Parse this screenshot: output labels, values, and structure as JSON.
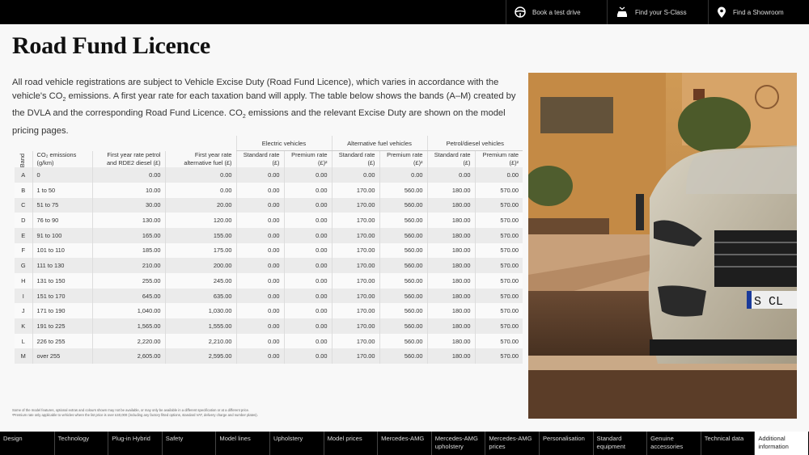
{
  "topbar": {
    "items": [
      {
        "label": "Book a test drive",
        "icon": "steering-wheel-icon"
      },
      {
        "label": "Find your S-Class",
        "icon": "car-search-icon"
      },
      {
        "label": "Find a Showroom",
        "icon": "map-pin-icon"
      }
    ]
  },
  "page": {
    "title": "Road Fund Licence",
    "intro_part1": "All road vehicle registrations are subject to Vehicle Excise Duty (Road Fund Licence), which varies in accordance with the vehicle's CO",
    "intro_part2": " emissions. A first year rate for each taxation band will apply. The table below shows the bands (A–M) created by the DVLA and the corresponding Road Fund Licence. CO",
    "intro_part3": " emissions and the relevant Excise Duty are shown on the model pricing pages.",
    "sub2": "2"
  },
  "table": {
    "group_headers": [
      "Electric vehicles",
      "Alternative fuel vehicles",
      "Petrol/diesel vehicles"
    ],
    "columns": {
      "band": "Band",
      "co2": "CO₂ emissions (g/km)",
      "first_petrol": "First year rate petrol and RDE2 diesel (£)",
      "first_alt": "First year rate alternative fuel (£)",
      "ev_std": "Standard rate (£)",
      "ev_prem": "Premium rate (£)²",
      "alt_std": "Standard rate (£)",
      "alt_prem": "Premium rate (£)²",
      "pd_std": "Standard rate (£)",
      "pd_prem": "Premium rate (£)²"
    },
    "rows": [
      [
        "A",
        "0",
        "0.00",
        "0.00",
        "0.00",
        "0.00",
        "0.00",
        "0.00",
        "0.00",
        "0.00"
      ],
      [
        "B",
        "1 to 50",
        "10.00",
        "0.00",
        "0.00",
        "0.00",
        "170.00",
        "560.00",
        "180.00",
        "570.00"
      ],
      [
        "C",
        "51 to 75",
        "30.00",
        "20.00",
        "0.00",
        "0.00",
        "170.00",
        "560.00",
        "180.00",
        "570.00"
      ],
      [
        "D",
        "76 to 90",
        "130.00",
        "120.00",
        "0.00",
        "0.00",
        "170.00",
        "560.00",
        "180.00",
        "570.00"
      ],
      [
        "E",
        "91 to 100",
        "165.00",
        "155.00",
        "0.00",
        "0.00",
        "170.00",
        "560.00",
        "180.00",
        "570.00"
      ],
      [
        "F",
        "101 to 110",
        "185.00",
        "175.00",
        "0.00",
        "0.00",
        "170.00",
        "560.00",
        "180.00",
        "570.00"
      ],
      [
        "G",
        "111 to 130",
        "210.00",
        "200.00",
        "0.00",
        "0.00",
        "170.00",
        "560.00",
        "180.00",
        "570.00"
      ],
      [
        "H",
        "131 to 150",
        "255.00",
        "245.00",
        "0.00",
        "0.00",
        "170.00",
        "560.00",
        "180.00",
        "570.00"
      ],
      [
        "I",
        "151 to 170",
        "645.00",
        "635.00",
        "0.00",
        "0.00",
        "170.00",
        "560.00",
        "180.00",
        "570.00"
      ],
      [
        "J",
        "171 to 190",
        "1,040.00",
        "1,030.00",
        "0.00",
        "0.00",
        "170.00",
        "560.00",
        "180.00",
        "570.00"
      ],
      [
        "K",
        "191 to 225",
        "1,565.00",
        "1,555.00",
        "0.00",
        "0.00",
        "170.00",
        "560.00",
        "180.00",
        "570.00"
      ],
      [
        "L",
        "226 to 255",
        "2,220.00",
        "2,210.00",
        "0.00",
        "0.00",
        "170.00",
        "560.00",
        "180.00",
        "570.00"
      ],
      [
        "M",
        "over 255",
        "2,605.00",
        "2,595.00",
        "0.00",
        "0.00",
        "170.00",
        "560.00",
        "180.00",
        "570.00"
      ]
    ]
  },
  "footnote": {
    "line1": "Some of the model features, optional extras and colours shown may not be available, or may only be available in a different specification or at a different price.",
    "line2": "²Premium rate only applicable to vehicles where the list price is over £40,000 (including any factory fitted options, standard VAT, delivery charge and number plates)."
  },
  "hero": {
    "alt": "Mercedes-Benz S-Class front view on city street",
    "plate": "S CL"
  },
  "bottomnav": {
    "items": [
      {
        "label": "Design"
      },
      {
        "label": "Technology"
      },
      {
        "label": "Plug-in Hybrid"
      },
      {
        "label": "Safety"
      },
      {
        "label": "Model lines"
      },
      {
        "label": "Upholstery"
      },
      {
        "label": "Model prices"
      },
      {
        "label": "Mercedes-AMG"
      },
      {
        "label": "Mercedes-AMG upholstery"
      },
      {
        "label": "Mercedes-AMG prices"
      },
      {
        "label": "Personalisation"
      },
      {
        "label": "Standard equipment"
      },
      {
        "label": "Genuine accessories"
      },
      {
        "label": "Technical data"
      },
      {
        "label": "Additional information",
        "active": true
      }
    ]
  }
}
